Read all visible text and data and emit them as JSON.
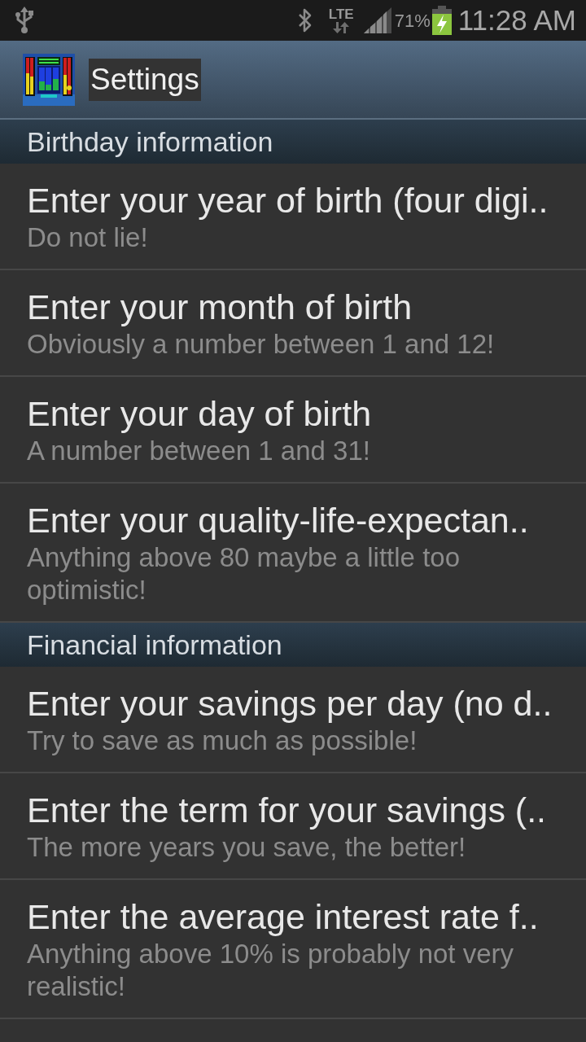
{
  "status_bar": {
    "network": "LTE",
    "battery": "71%",
    "time": "11:28 AM"
  },
  "action_bar": {
    "title": "Settings"
  },
  "sections": [
    {
      "header": "Birthday information",
      "items": [
        {
          "title": "Enter your year of birth (four digi..",
          "summary": "Do not lie!"
        },
        {
          "title": "Enter your month of birth",
          "summary": "Obviously a number between 1 and 12!"
        },
        {
          "title": "Enter your day of birth",
          "summary": "A number between 1 and 31!"
        },
        {
          "title": "Enter your quality-life-expectan..",
          "summary": "Anything above 80 maybe a little too optimistic!"
        }
      ]
    },
    {
      "header": "Financial information",
      "items": [
        {
          "title": "Enter your savings per day (no d..",
          "summary": "Try to save as much as possible!"
        },
        {
          "title": "Enter the term for your savings (..",
          "summary": "The more years you save, the better!"
        },
        {
          "title": "Enter the average interest rate f..",
          "summary": "Anything above 10% is probably not very realistic!"
        }
      ]
    }
  ]
}
